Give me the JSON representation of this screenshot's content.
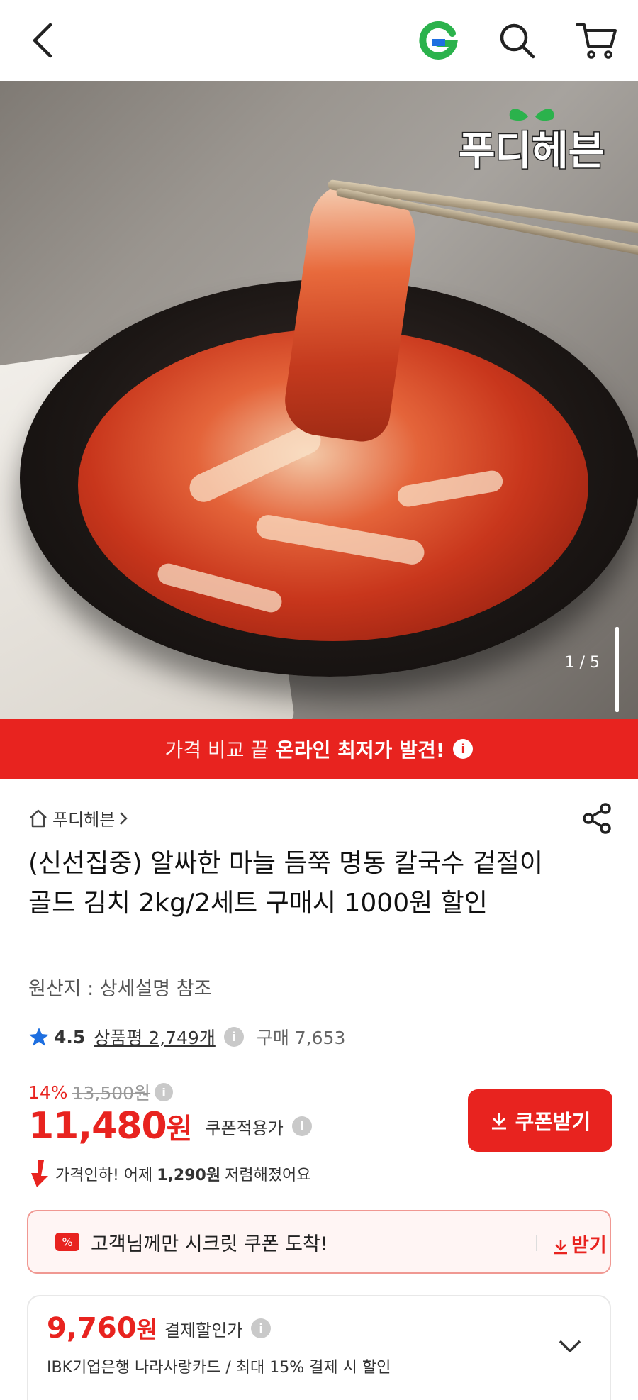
{
  "header": {
    "back_icon": "back-arrow-icon",
    "g_logo_icon": "g-logo-icon",
    "search_icon": "search-icon",
    "cart_icon": "cart-icon"
  },
  "hero": {
    "brand_logo_text": "푸디헤븐",
    "indicator": "1 / 5"
  },
  "promo_banner": {
    "light_text": "가격 비교 끝",
    "bold_text": "온라인 최저가 발견!",
    "color": "#e8231f"
  },
  "product": {
    "store_name": "푸디헤븐",
    "title": "(신선집중) 알싸한 마늘 듬쭉 명동 칼국수 겉절이 골드 김치 2kg/2세트 구매시 1000원 할인",
    "origin": "원산지 : 상세설명 참조",
    "rating": "4.5",
    "review_label": "상품평 2,749개",
    "purchase_count": "구매 7,653",
    "discount_pct": "14%",
    "original_price": "13,500원",
    "price": "11,480",
    "price_unit": "원",
    "coupon_applied_label": "쿠폰적용가",
    "coupon_button_label": "쿠폰받기",
    "price_drop_prefix": "가격인하! 어제",
    "price_drop_amount": "1,290원",
    "price_drop_suffix": "저렴해졌어요"
  },
  "secret_coupon": {
    "tag": "%",
    "text": "고객님께만 시크릿 쿠폰 도착!",
    "get_label": "받기"
  },
  "card_discount": {
    "price": "9,760",
    "price_unit": "원",
    "label": "결제할인가",
    "description": "IBK기업은행 나라사랑카드 / 최대 15% 결제 시 할인"
  },
  "colors": {
    "accent": "#e8231f",
    "star": "#1e6fe0",
    "g_green": "#2bb24c"
  }
}
